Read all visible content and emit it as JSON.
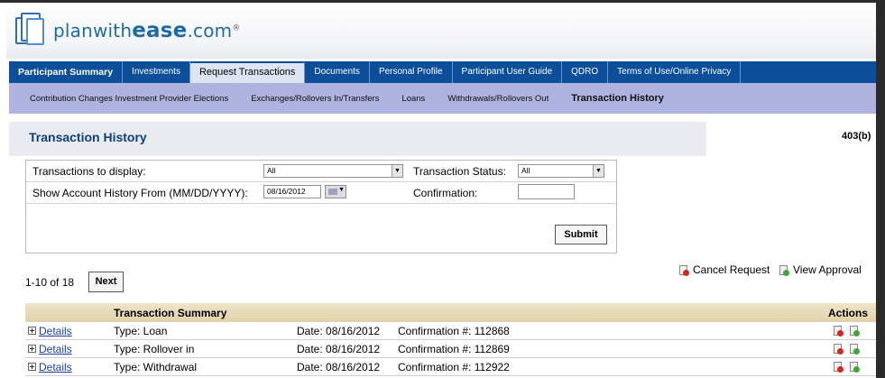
{
  "brand": {
    "name_prefix": "planwith",
    "name_bold": "ease",
    "name_suffix": ".com",
    "mark": "®"
  },
  "main_nav": [
    {
      "label": "Participant Summary",
      "active": false
    },
    {
      "label": "Investments",
      "active": false
    },
    {
      "label": "Request Transactions",
      "active": true
    },
    {
      "label": "Documents",
      "active": false
    },
    {
      "label": "Personal Profile",
      "active": false
    },
    {
      "label": "Participant User Guide",
      "active": false
    },
    {
      "label": "QDRO",
      "active": false
    },
    {
      "label": "Terms of Use/Online Privacy",
      "active": false
    }
  ],
  "sub_nav": [
    {
      "label": "Contribution Changes Investment Provider Elections",
      "active": false
    },
    {
      "label": "Exchanges/Rollovers In/Transfers",
      "active": false
    },
    {
      "label": "Loans",
      "active": false
    },
    {
      "label": "Withdrawals/Rollovers Out",
      "active": false
    },
    {
      "label": "Transaction History",
      "active": true
    }
  ],
  "page": {
    "title": "Transaction History",
    "plan_type": "403(b)"
  },
  "form": {
    "transactions_label": "Transactions to display:",
    "transactions_value": "All",
    "status_label": "Transaction Status:",
    "status_value": "All",
    "history_label": "Show Account History From (MM/DD/YYYY):",
    "history_value": "08/16/2012",
    "confirmation_label": "Confirmation:",
    "confirmation_value": "",
    "submit_label": "Submit"
  },
  "legend": {
    "cancel_label": "Cancel Request",
    "approval_label": "View Approval"
  },
  "pager": {
    "range": "1-10 of 18",
    "next_label": "Next"
  },
  "table": {
    "header_summary": "Transaction Summary",
    "header_actions": "Actions",
    "rows": [
      {
        "details": "Details",
        "type": "Type: Loan",
        "date": "Date: 08/16/2012",
        "confirmation": "Confirmation #: 112868"
      },
      {
        "details": "Details",
        "type": "Type: Rollover in",
        "date": "Date: 08/16/2012",
        "confirmation": "Confirmation #: 112869"
      },
      {
        "details": "Details",
        "type": "Type: Withdrawal",
        "date": "Date: 08/16/2012",
        "confirmation": "Confirmation #: 112922"
      }
    ]
  },
  "colors": {
    "nav_blue": "#0b4f9b",
    "subnav_lavender": "#aeb3df",
    "title_blue": "#0b3f80",
    "cancel_red": "#d9261c",
    "approve_green": "#3fa535"
  }
}
